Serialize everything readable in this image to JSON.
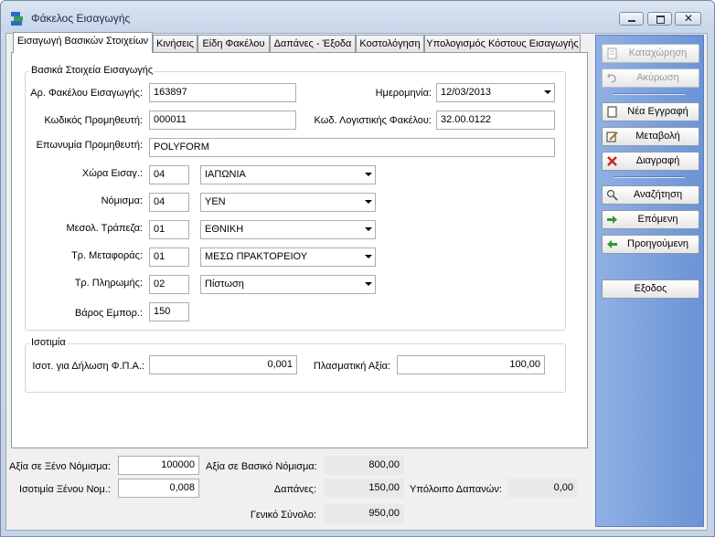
{
  "window": {
    "title": "Φάκελος Εισαγωγής"
  },
  "tabs": [
    "Εισαγωγή Βασικών Στοιχείων",
    "Κινήσεις",
    "Είδη Φακέλου",
    "Δαπάνες - Έξοδα",
    "Κοστολόγηση",
    "Υπολογισμός Κόστους Εισαγωγής"
  ],
  "basic": {
    "group_title": "Βασικά Στοιχεία Εισαγωγής",
    "folder_no_label": "Αρ. Φακέλου Εισαγωγής:",
    "folder_no": "163897",
    "date_label": "Ημερομηνία:",
    "date": "12/03/2013",
    "supplier_code_label": "Κωδικός Προμηθευτή:",
    "supplier_code": "000011",
    "account_code_label": "Κωδ. Λογιστικής Φακέλου:",
    "account_code": "32.00.0122",
    "supplier_name_label": "Επωνυμία Προμηθευτή:",
    "supplier_name": "POLYFORM",
    "country_label": "Χώρα Εισαγ.:",
    "country_code": "04",
    "country": "ΙΑΠΩΝΙΑ",
    "currency_label": "Νόμισμα:",
    "currency_code": "04",
    "currency": "YEN",
    "bank_label": "Μεσολ. Τράπεζα:",
    "bank_code": "01",
    "bank": "ΕΘΝΙΚΗ",
    "transport_label": "Τρ. Μεταφοράς:",
    "transport_code": "01",
    "transport": "ΜΕΣΩ ΠΡΑΚΤΟΡΕΙΟΥ",
    "payment_label": "Τρ. Πληρωμής:",
    "payment_code": "02",
    "payment": "Πίστωση",
    "weight_label": "Βάρος Εμπορ.:",
    "weight": "150"
  },
  "parity": {
    "group_title": "Ισοτιμία",
    "vat_parity_label": "Ισοτ. για Δήλωση Φ.Π.Α.:",
    "vat_parity": "0,001",
    "fictitious_label": "Πλασματική Αξία:",
    "fictitious": "100,00"
  },
  "totals": {
    "foreign_value_label": "Αξία σε Ξένο Νόμισμα:",
    "foreign_value": "100000",
    "base_value_label": "Αξία σε Βασικό Νόμισμα:",
    "base_value": "800,00",
    "foreign_rate_label": "Ισοτιμία Ξένου Νομ.:",
    "foreign_rate": "0,008",
    "expenses_label": "Δαπάνες:",
    "expenses": "150,00",
    "remaining_label": "Υπόλοιπο Δαπανών:",
    "remaining": "0,00",
    "grand_total_label": "Γενικό Σύνολο:",
    "grand_total": "950,00"
  },
  "actions": {
    "save": "Καταχώρηση",
    "cancel": "Ακύρωση",
    "new": "Νέα Εγγραφή",
    "edit": "Μεταβολή",
    "delete": "Διαγραφή",
    "search": "Αναζήτηση",
    "next": "Επόμενη",
    "previous": "Προηγούμενη",
    "exit": "Εξοδος"
  }
}
